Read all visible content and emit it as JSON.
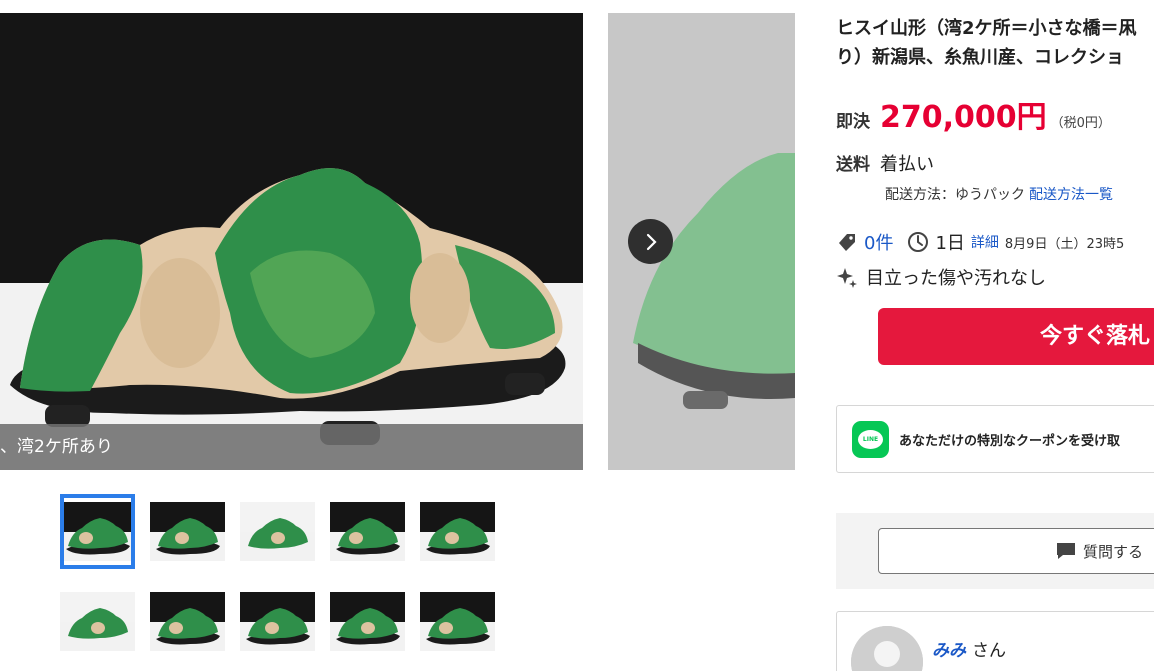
{
  "gallery": {
    "caption": "、湾2ケ所あり",
    "next_button_label": "›",
    "thumbnail_count": 10,
    "active_thumbnail": 1
  },
  "item": {
    "title_line1": "ヒスイ山形（湾2ケ所＝小さな橋＝凩",
    "title_line2": "り）新潟県、糸魚川産、コレクショ"
  },
  "price": {
    "label": "即決",
    "value": "270,000円",
    "tax": "（税0円）"
  },
  "shipping": {
    "label": "送料",
    "value": "着払い",
    "method_text": "配送方法：ゆうパック",
    "method_link": "配送方法一覧"
  },
  "stats": {
    "watch_count": "0件",
    "time_left": "1日",
    "detail_link": "詳細",
    "end_date": "8月9日（土）23時5"
  },
  "condition": {
    "text": "目立った傷や汚れなし"
  },
  "actions": {
    "buy_now": "今すぐ落札",
    "line_coupon": "あなただけの特別なクーポンを受け取",
    "line_badge": "LINE",
    "question": "質問する"
  },
  "seller": {
    "name": "みみ",
    "suffix": "さん"
  },
  "colors": {
    "price_red": "#e60033",
    "buy_button": "#e5183d",
    "link_blue": "#1a58c7",
    "line_green": "#06c755",
    "jade_green": "#2f8f4a",
    "active_thumb_border": "#2b7de9"
  }
}
